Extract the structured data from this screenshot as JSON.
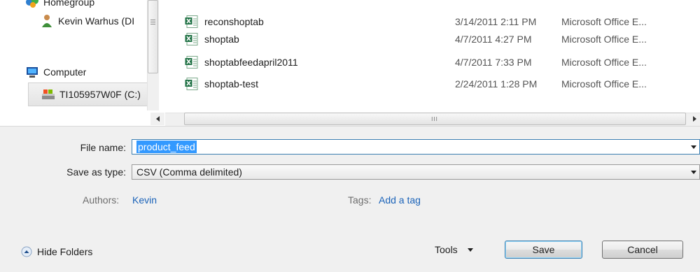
{
  "nav": {
    "items": [
      {
        "label": "Homegroup",
        "icon": "homegroup-icon"
      },
      {
        "label": "Kevin Warhus (DI",
        "icon": "user-icon"
      },
      {
        "label": "Computer",
        "icon": "computer-icon"
      },
      {
        "label": "TI105957W0F (C:)",
        "icon": "drive-icon"
      }
    ]
  },
  "files": [
    {
      "name": "reconshoptab",
      "date": "3/14/2011 2:11 PM",
      "type": "Microsoft Office E..."
    },
    {
      "name": "shoptab",
      "date": "4/7/2011 4:27 PM",
      "type": "Microsoft Office E..."
    },
    {
      "name": "shoptabfeedapril2011",
      "date": "4/7/2011 7:33 PM",
      "type": "Microsoft Office E..."
    },
    {
      "name": "shoptab-test",
      "date": "2/24/2011 1:28 PM",
      "type": "Microsoft Office E..."
    }
  ],
  "scroll_grip": "III",
  "form": {
    "filename_label": "File name:",
    "filename_value": "product_feed",
    "savetype_label": "Save as type:",
    "savetype_value": "CSV (Comma delimited)",
    "authors_label": "Authors:",
    "authors_value": "Kevin",
    "tags_label": "Tags:",
    "tags_value": "Add a tag"
  },
  "footer": {
    "hide_folders": "Hide Folders",
    "tools": "Tools",
    "save": "Save",
    "cancel": "Cancel"
  },
  "colors": {
    "link": "#1b63b9",
    "selection": "#3399ff",
    "excel_green": "#207245"
  }
}
